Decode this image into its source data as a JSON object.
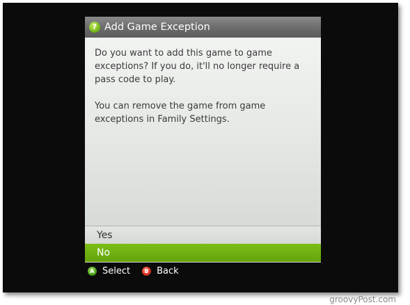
{
  "dialog": {
    "title": "Add Game Exception",
    "help_icon": "?",
    "paragraphs": [
      "Do you want to add this game to game exceptions? If you do, it'll no longer require a pass code to play.",
      "You can remove the game from game exceptions in Family Settings."
    ],
    "options": [
      {
        "label": "Yes",
        "selected": false
      },
      {
        "label": "No",
        "selected": true
      }
    ]
  },
  "legend": {
    "a_button": {
      "glyph": "A",
      "label": "Select"
    },
    "b_button": {
      "glyph": "B",
      "label": "Back"
    }
  },
  "watermark": "groovyPost.com",
  "colors": {
    "accent_green": "#6ab00f",
    "title_bar": "#6b6b6b",
    "background": "#0b0b0b"
  }
}
